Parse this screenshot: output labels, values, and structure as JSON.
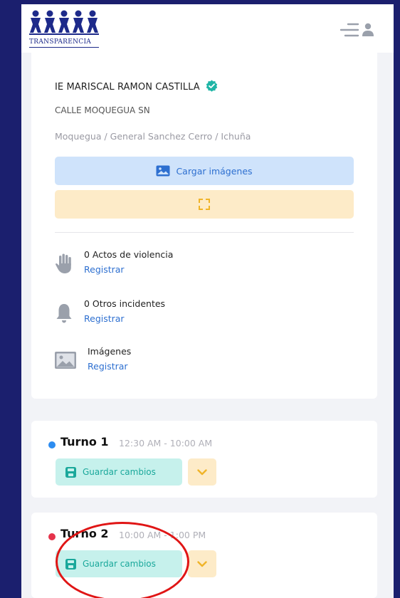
{
  "header": {
    "logo_text": "TRANSPARENCIA",
    "menu_icon": "menu-lines-icon",
    "user_icon": "user-icon"
  },
  "school": {
    "name": "IE MARISCAL RAMON CASTILLA",
    "verified_icon": "verified-badge-icon",
    "address": "CALLE MOQUEGUA SN",
    "location": "Moquegua / General Sanchez Cerro / Ichuña"
  },
  "actions": {
    "upload_label": "Cargar imágenes",
    "upload_icon": "image-icon",
    "expand_icon": "expand-icon"
  },
  "incidents": [
    {
      "title": "0 Actos de violencia",
      "link": "Registrar",
      "icon": "hand-icon"
    },
    {
      "title": "0 Otros incidentes",
      "link": "Registrar",
      "icon": "bell-icon"
    },
    {
      "title": "Imágenes",
      "link": "Registrar",
      "icon": "image-icon"
    }
  ],
  "turnos": [
    {
      "name": "Turno 1",
      "time": "12:30 AM - 10:00 AM",
      "dot_color": "#2d8cf0",
      "save_label": "Guardar cambios"
    },
    {
      "name": "Turno 2",
      "time": "10:00 AM - 1:00 PM",
      "dot_color": "#e5334b",
      "save_label": "Guardar cambios"
    }
  ],
  "colors": {
    "background": "#1b1f6e",
    "accent_blue": "#2d6fd0",
    "save_teal": "#1aa89b",
    "warning_amber": "#f0b429",
    "annotation_red": "#e01515"
  }
}
